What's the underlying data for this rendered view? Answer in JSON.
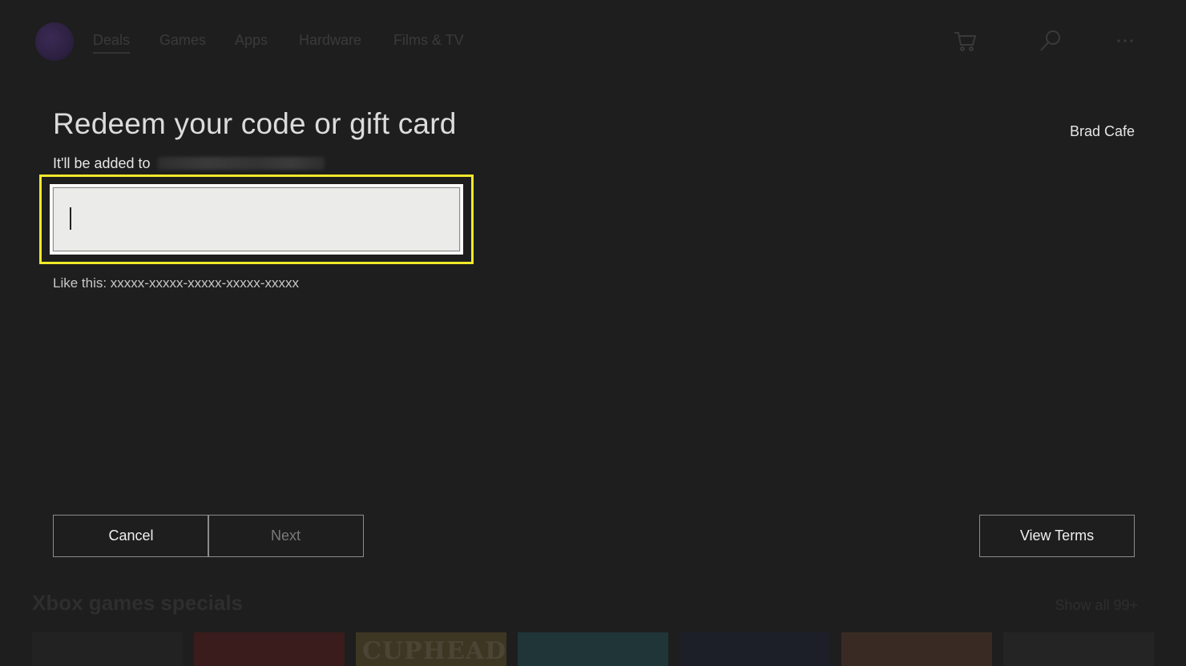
{
  "nav": {
    "items": [
      "Deals",
      "Games",
      "Apps",
      "Hardware",
      "Films & TV"
    ],
    "icons": [
      "cart-icon",
      "search-icon",
      "more-icon"
    ]
  },
  "dialog": {
    "title": "Redeem your code or gift card",
    "added_to_label": "It'll be added to",
    "username": "Brad Cafe",
    "code_input": {
      "value": "",
      "placeholder": ""
    },
    "hint": "Like this: xxxxx-xxxxx-xxxxx-xxxxx-xxxxx",
    "cancel_label": "Cancel",
    "next_label": "Next",
    "view_terms_label": "View Terms"
  },
  "background": {
    "specials_title": "Xbox games specials",
    "show_all": "Show all 99+",
    "tile_text": "CUPHEAD"
  },
  "colors": {
    "highlight": "#f0e92a",
    "background": "#1e1e1e"
  }
}
